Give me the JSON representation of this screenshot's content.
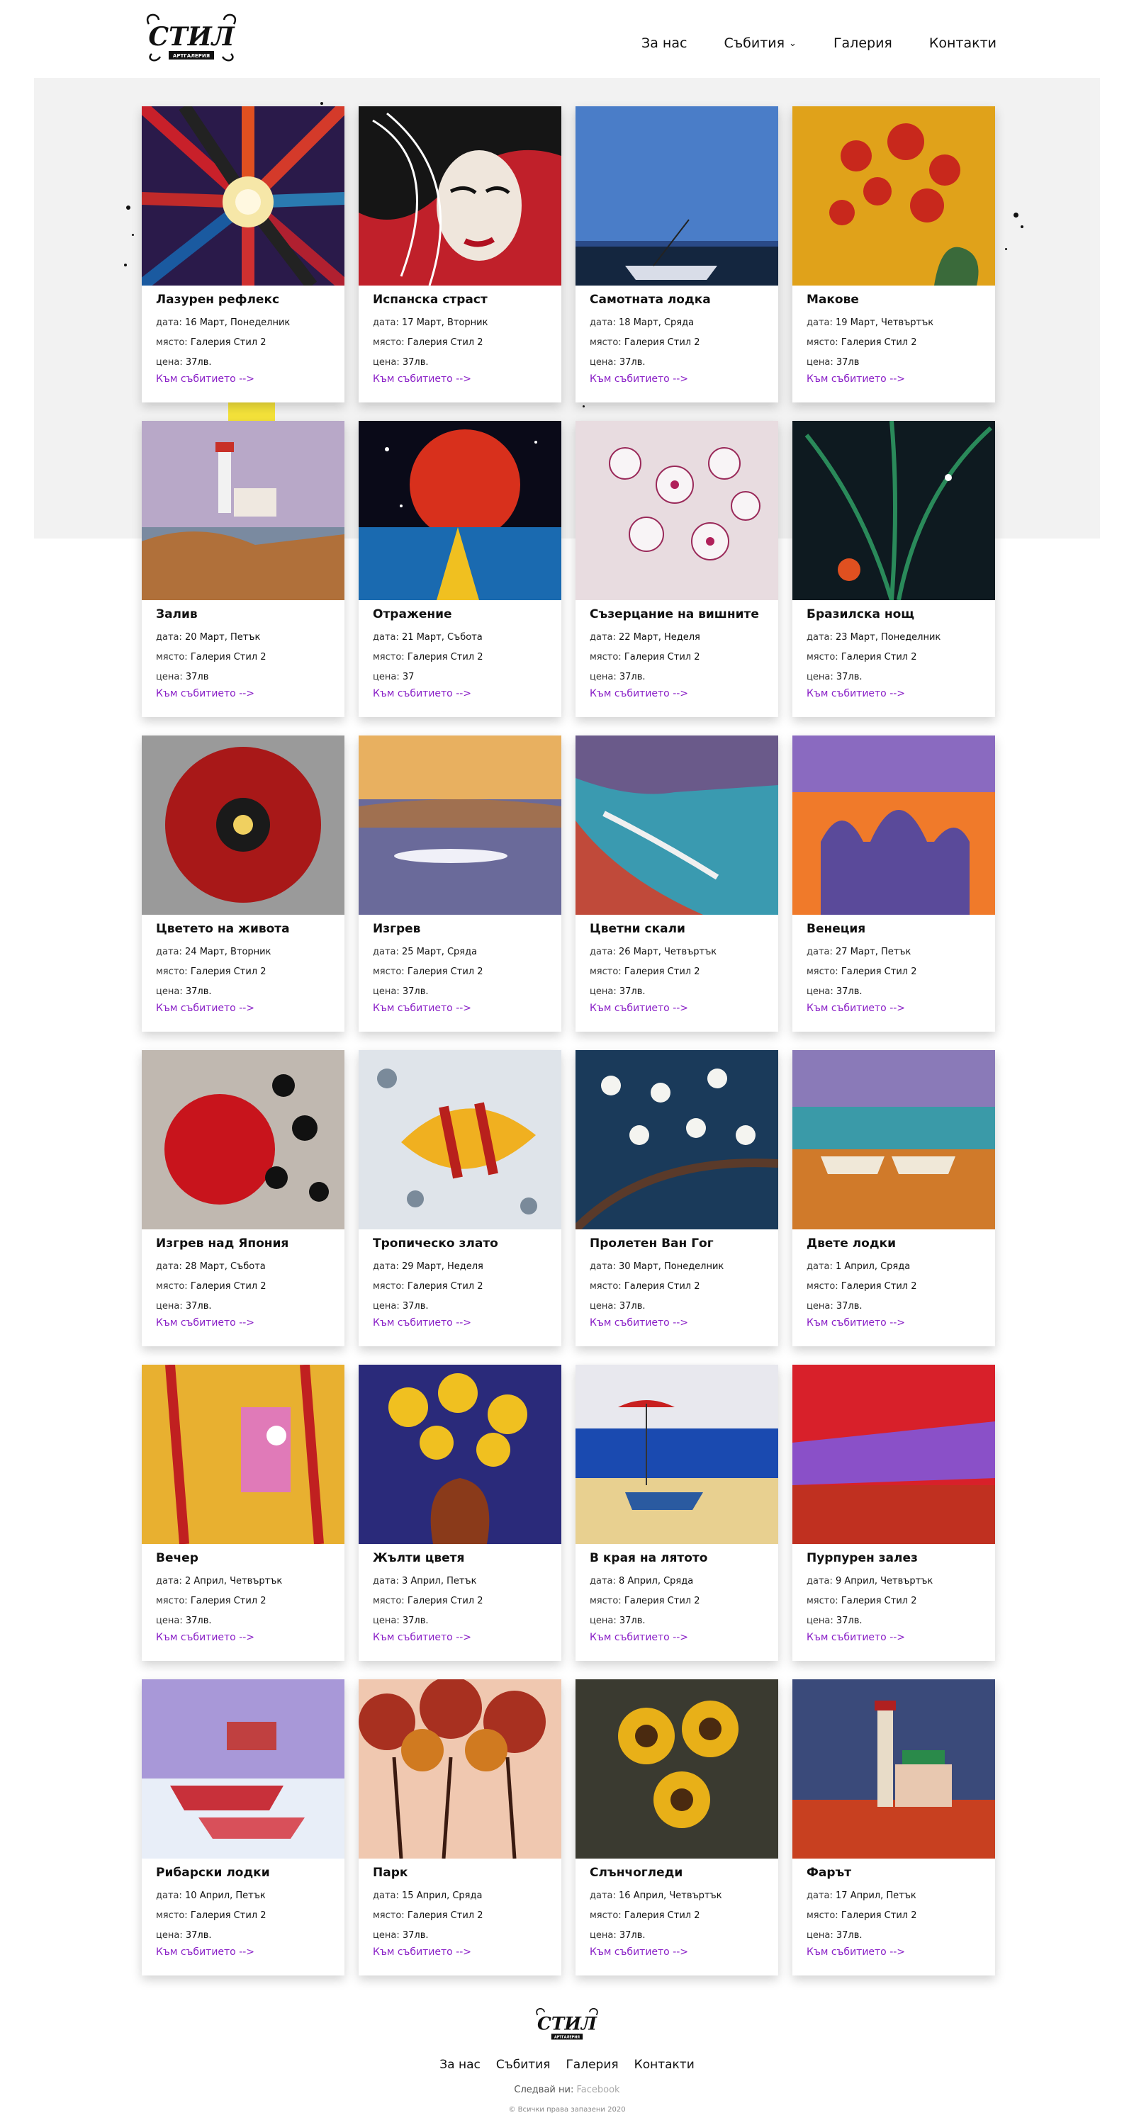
{
  "header": {
    "logo_text": "СТИЛ",
    "logo_sub": "АРТГАЛЕРИЯ",
    "nav": [
      {
        "label": "За нас"
      },
      {
        "label": "Събития"
      },
      {
        "label": "Галерия"
      },
      {
        "label": "Контакти"
      }
    ]
  },
  "labels": {
    "date": "дата:",
    "place": "място:",
    "price": "цена:",
    "link": "Към събитието -->"
  },
  "events": [
    {
      "title": "Лазурен рефлекс",
      "date": "16 Март, Понеделник",
      "place": "Галерия Стил 2",
      "price": "37лв.",
      "art": "sunburst"
    },
    {
      "title": "Испанска страст",
      "date": "17 Март, Вторник",
      "place": "Галерия Стил 2",
      "price": "37лв.",
      "art": "face"
    },
    {
      "title": "Самотната лодка",
      "date": "18 Март, Сряда",
      "place": "Галерия Стил 2",
      "price": "37лв.",
      "art": "boat"
    },
    {
      "title": "Макове",
      "date": "19 Март, Четвъртък",
      "place": "Галерия Стил 2",
      "price": "37лв",
      "art": "poppies"
    },
    {
      "title": "Залив",
      "date": "20 Март, Петък",
      "place": "Галерия Стил 2",
      "price": "37лв",
      "art": "lighthouse"
    },
    {
      "title": "Отражение",
      "date": "21 Март, Събота",
      "place": "Галерия Стил 2",
      "price": "37",
      "art": "moon"
    },
    {
      "title": "Съзерцание на вишните",
      "date": "22 Март, Неделя",
      "place": "Галерия Стил 2",
      "price": "37лв.",
      "art": "cherry"
    },
    {
      "title": "Бразилска нощ",
      "date": "23 Март, Понеделник",
      "place": "Галерия Стил 2",
      "price": "37лв.",
      "art": "night"
    },
    {
      "title": "Цветето на живота",
      "date": "24 Март, Вторник",
      "place": "Галерия Стил 2",
      "price": "37лв.",
      "art": "redflower"
    },
    {
      "title": "Изгрев",
      "date": "25 Март, Сряда",
      "place": "Галерия Стил 2",
      "price": "37лв.",
      "art": "sunrise"
    },
    {
      "title": "Цветни скали",
      "date": "26 Март, Четвъртък",
      "place": "Галерия Стил 2",
      "price": "37лв.",
      "art": "rocks"
    },
    {
      "title": "Венеция",
      "date": "27 Март, Петък",
      "place": "Галерия Стил 2",
      "price": "37лв.",
      "art": "venice"
    },
    {
      "title": "Изгрев над Япония",
      "date": "28 Март, Събота",
      "place": "Галерия Стил 2",
      "price": "37лв.",
      "art": "japan"
    },
    {
      "title": "Тропическо злато",
      "date": "29 Март, Неделя",
      "place": "Галерия Стил 2",
      "price": "37лв.",
      "art": "fish"
    },
    {
      "title": "Пролетен Ван Гог",
      "date": "30 Март, Понеделник",
      "place": "Галерия Стил 2",
      "price": "37лв.",
      "art": "blossom"
    },
    {
      "title": "Двете лодки",
      "date": "1 Април, Сряда",
      "place": "Галерия Стил 2",
      "price": "37лв.",
      "art": "twoboats"
    },
    {
      "title": "Вечер",
      "date": "2 Април, Четвъртък",
      "place": "Галерия Стил 2",
      "price": "37лв.",
      "art": "evening"
    },
    {
      "title": "Жълти цветя",
      "date": "3 Април, Петък",
      "place": "Галерия Стил 2",
      "price": "37лв.",
      "art": "yellowflowers"
    },
    {
      "title": "В края на лятото",
      "date": "8 Април, Сряда",
      "place": "Галерия Стил 2",
      "price": "37лв.",
      "art": "beach"
    },
    {
      "title": "Пурпурен залез",
      "date": "9 Април, Четвъртък",
      "place": "Галерия Стил 2",
      "price": "37лв.",
      "art": "purplesunset"
    },
    {
      "title": "Рибарски лодки",
      "date": "10 Април, Петък",
      "place": "Галерия Стил 2",
      "price": "37лв.",
      "art": "fishingboats"
    },
    {
      "title": "Парк",
      "date": "15 Април, Сряда",
      "place": "Галерия Стил 2",
      "price": "37лв.",
      "art": "park"
    },
    {
      "title": "Слънчогледи",
      "date": "16 Април, Четвъртък",
      "place": "Галерия Стил 2",
      "price": "37лв.",
      "art": "sunflowers"
    },
    {
      "title": "Фарът",
      "date": "17 Април, Петък",
      "place": "Галерия Стил 2",
      "price": "37лв.",
      "art": "lighthouse2"
    }
  ],
  "footer": {
    "nav": [
      {
        "label": "За нас"
      },
      {
        "label": "Събития"
      },
      {
        "label": "Галерия"
      },
      {
        "label": "Контакти"
      }
    ],
    "follow_label": "Следвай ни:",
    "facebook": "Facebook",
    "copyright": "© Всички права запазени 2020"
  },
  "colors": {
    "link": "#8a20c7",
    "band": "#f2f2f2",
    "highlight": "#f5e33a"
  }
}
